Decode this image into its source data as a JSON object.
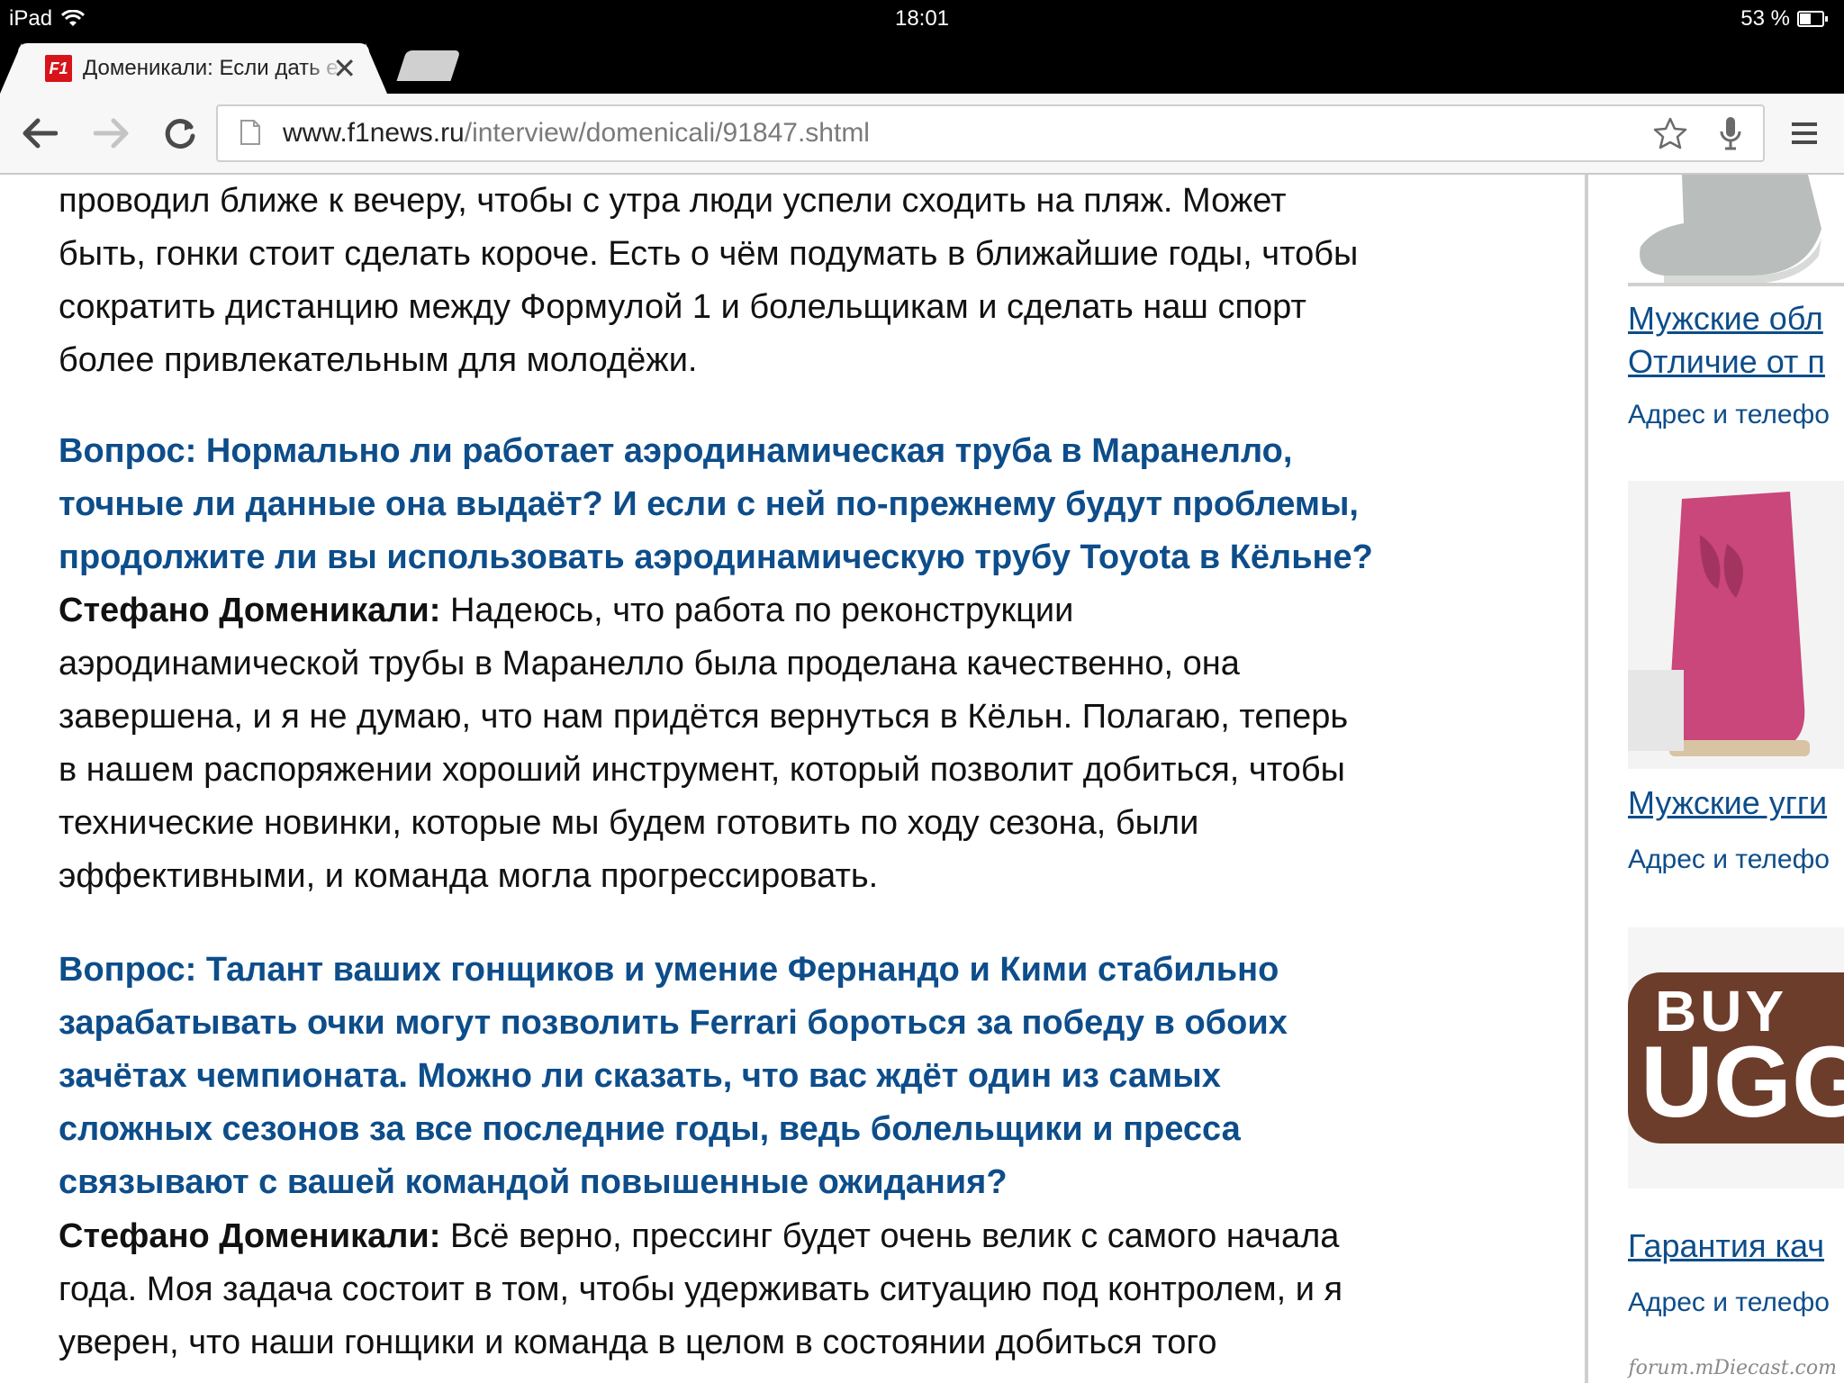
{
  "status_bar": {
    "device": "iPad",
    "time": "18:01",
    "battery": "53 %"
  },
  "tabs": [
    {
      "title": "Доменикали: Если дать ещё",
      "favicon": "F1"
    }
  ],
  "toolbar": {
    "url_host": "www.f1news.ru",
    "url_path": "/interview/domenicali/91847.shtml"
  },
  "article": {
    "intro_lines": [
      "проводил ближе к вечеру, чтобы с утра люди успели сходить на пляж. Может",
      "быть, гонки стоит сделать короче. Есть о чём подумать в ближайшие годы, чтобы",
      "сократить дистанцию между Формулой 1 и болельщикам и сделать наш спорт",
      "более привлекательным для молодёжи."
    ],
    "q1_lines": [
      "Вопрос: Нормально ли работает аэродинамическая труба в Маранелло,",
      "точные ли данные она выдаёт? И если с ней по-прежнему будут проблемы,",
      "продолжите ли вы использовать аэродинамическую трубу Toyota в Кёльне?"
    ],
    "a1_name": "Стефано Доменикали:",
    "a1_first": " Надеюсь, что работа по реконструкции",
    "a1_lines": [
      "аэродинамической трубы в Маранелло была проделана качественно, она",
      "завершена, и я не думаю, что нам придётся вернуться в Кёльн. Полагаю, теперь",
      "в нашем распоряжении хороший инструмент, который позволит добиться, чтобы",
      "технические новинки, которые мы будем готовить по ходу сезона, были",
      "эффективными, и команда могла прогрессировать."
    ],
    "q2_lines": [
      "Вопрос: Талант ваших гонщиков и умение Фернандо и Кими стабильно",
      "зарабатывать очки могут позволить Ferrari бороться за победу в обоих",
      "зачётах чемпионата. Можно ли сказать, что вас ждёт один из самых",
      "сложных сезонов за все последние годы, ведь болельщики и пресса",
      "связывают с вашей командой повышенные ожидания?"
    ],
    "a2_name": "Стефано Доменикали:",
    "a2_first": " Всё верно, прессинг будет очень велик с самого начала",
    "a2_lines": [
      "года. Моя задача состоит в том, чтобы удерживать ситуацию под контролем, и я",
      "уверен, что наши гонщики и команда в целом в состоянии добиться того"
    ]
  },
  "sidebar": {
    "ads": [
      {
        "link_lines": [
          "Мужские обл",
          "Отличие от п"
        ],
        "sub": "Адрес и телефо"
      },
      {
        "link_lines": [
          "Мужские угги"
        ],
        "sub": "Адрес и телефо"
      },
      {
        "link_lines": [
          "Гарантия кач"
        ],
        "sub": "Адрес и телефо",
        "logo_text_1": "BUY",
        "logo_text_2": "UGG"
      }
    ],
    "watermark": "forum.mDiecast.com"
  }
}
